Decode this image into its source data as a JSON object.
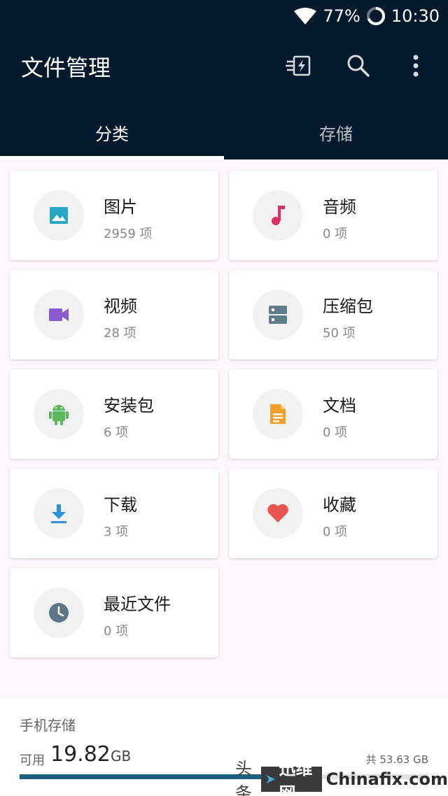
{
  "status_bar": {
    "battery": "77%",
    "time": "10:30",
    "icons": [
      "wifi-icon",
      "battery-ring-icon"
    ]
  },
  "app_bar": {
    "title": "文件管理",
    "actions": [
      "flash-transfer-icon",
      "search-icon",
      "more-vert-icon"
    ]
  },
  "tabs": [
    {
      "label": "分类",
      "active": true
    },
    {
      "label": "存储",
      "active": false
    }
  ],
  "categories": [
    {
      "name": "图片",
      "count": "2959 项",
      "icon": "image-icon",
      "color": "#26a8c4"
    },
    {
      "name": "音频",
      "count": "0 项",
      "icon": "music-note-icon",
      "color": "#d8315b"
    },
    {
      "name": "视频",
      "count": "28 项",
      "icon": "video-camera-icon",
      "color": "#8a5ad0"
    },
    {
      "name": "压缩包",
      "count": "50 项",
      "icon": "archive-icon",
      "color": "#607d8b"
    },
    {
      "name": "安装包",
      "count": "6 项",
      "icon": "android-icon",
      "color": "#5cb85c"
    },
    {
      "name": "文档",
      "count": "0 项",
      "icon": "document-icon",
      "color": "#f0a02a"
    },
    {
      "name": "下载",
      "count": "3 项",
      "icon": "download-icon",
      "color": "#2f8fe0"
    },
    {
      "name": "收藏",
      "count": "0 项",
      "icon": "heart-icon",
      "color": "#e85450"
    },
    {
      "name": "最近文件",
      "count": "0 项",
      "icon": "clock-icon",
      "color": "#5f7684"
    }
  ],
  "storage": {
    "title": "手机存储",
    "available_label": "可用",
    "available_value": "19.82",
    "available_unit": "GB",
    "total": "共 53.63 GB",
    "used_fraction": 0.63
  },
  "watermark": {
    "prefix": "头条",
    "brand": "迅维网",
    "site": "Chinafix.com"
  },
  "colors": {
    "topbar": "#04192b",
    "accent": "#1d5f7e",
    "background": "#fdf8fc"
  }
}
